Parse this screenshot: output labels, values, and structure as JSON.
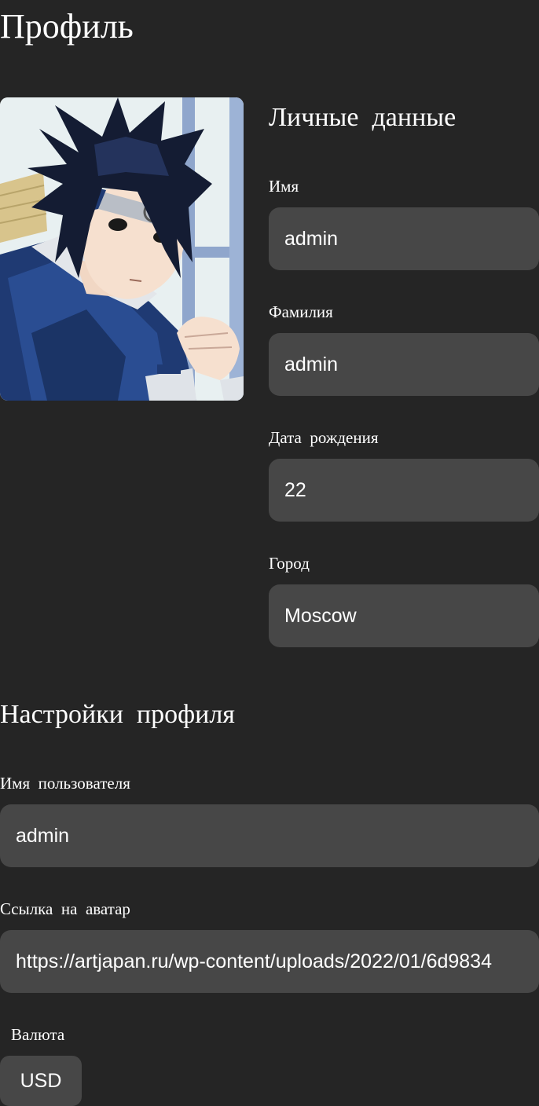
{
  "page": {
    "title": "Профиль"
  },
  "avatar": {
    "alt": "Аватар пользователя"
  },
  "personal": {
    "title": "Личные  данные",
    "fields": [
      {
        "label": "Имя",
        "value": "admin"
      },
      {
        "label": "Фамилия",
        "value": "admin"
      },
      {
        "label": "Дата  рождения",
        "value": "22"
      },
      {
        "label": "Город",
        "value": "Moscow"
      }
    ]
  },
  "settings": {
    "title": "Настройки  профиля",
    "username_label": "Имя  пользователя",
    "username_value": "admin",
    "avatar_link_label": "Ссылка  на  аватар",
    "avatar_link_value": "https://artjapan.ru/wp-content/uploads/2022/01/6d9834",
    "currency_label": "Валюта",
    "currency_value": "USD"
  },
  "colors": {
    "background": "#252525",
    "input_background": "#474747",
    "text": "#ffffff"
  }
}
